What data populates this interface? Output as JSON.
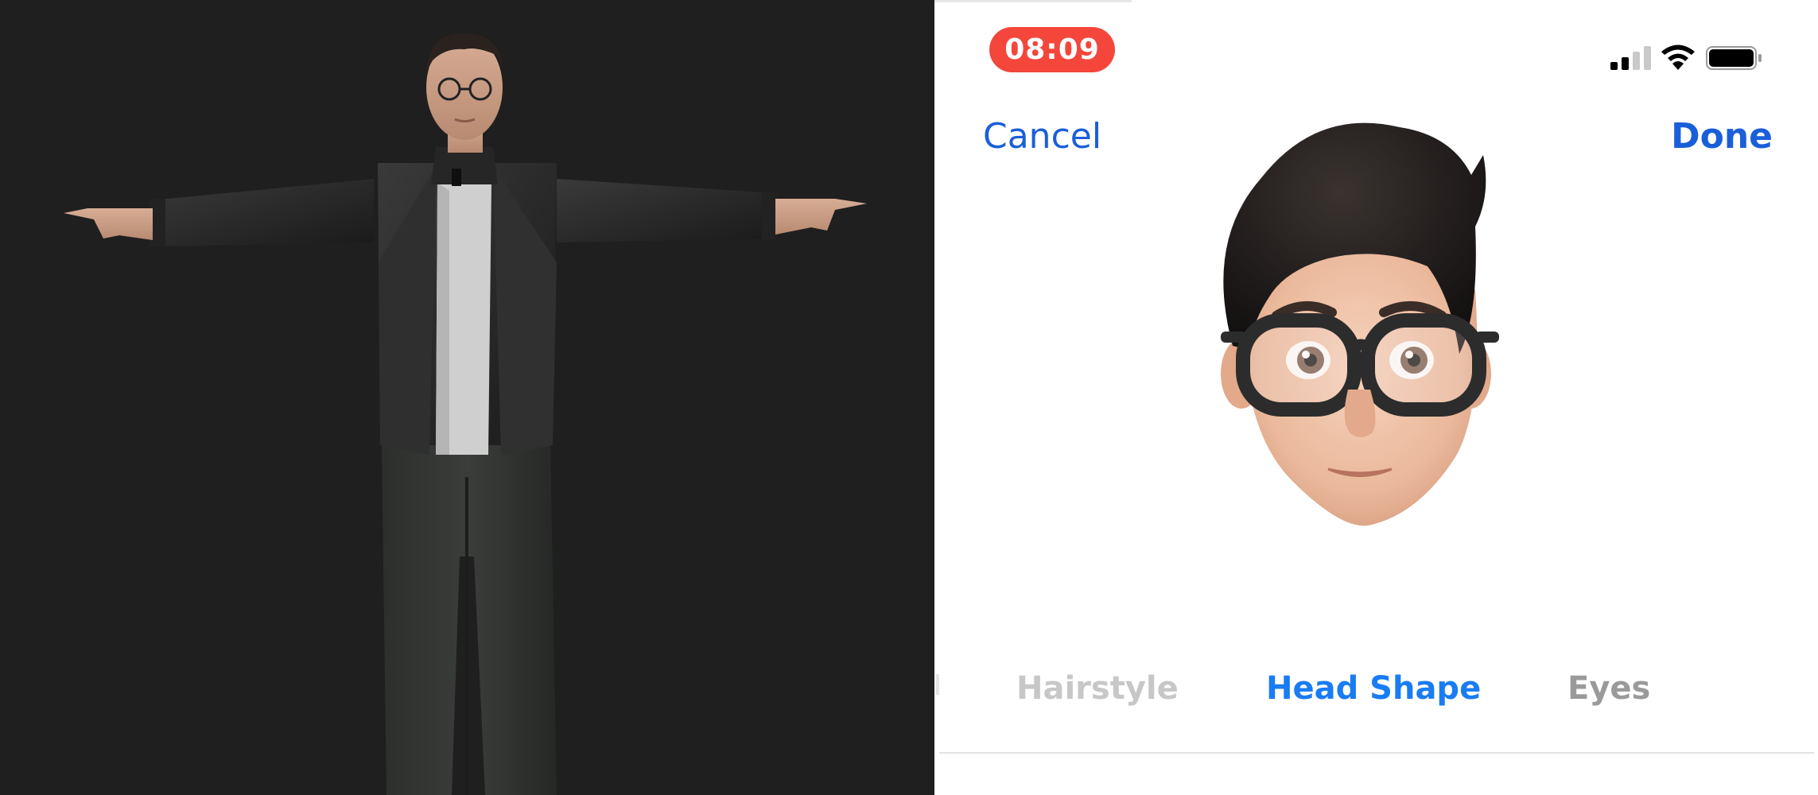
{
  "status_bar": {
    "time": "08:09",
    "icons": [
      "cellular-signal-icon",
      "wifi-icon",
      "battery-icon"
    ]
  },
  "navigation": {
    "cancel_label": "Cancel",
    "done_label": "Done"
  },
  "category_tabs": [
    {
      "label": "Hairstyle",
      "state": "fading"
    },
    {
      "label": "Head Shape",
      "state": "selected"
    },
    {
      "label": "Eyes",
      "state": "unselected"
    }
  ],
  "colors": {
    "accent_blue": "#1a7cf2",
    "nav_blue": "#1a5fd9",
    "time_pill_red": "#f4463b",
    "viewport_bg": "#1f1f1f"
  }
}
